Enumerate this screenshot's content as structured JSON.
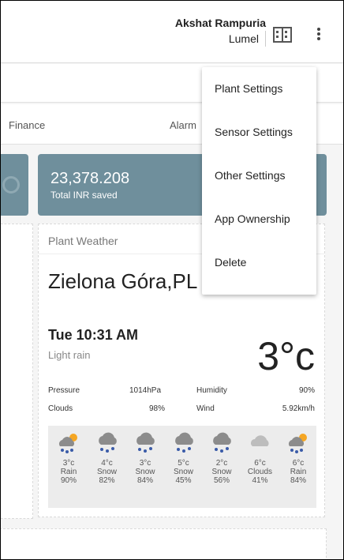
{
  "header": {
    "user_name": "Akshat Rampuria",
    "org_name": "Lumel"
  },
  "tabs": {
    "finance": "Finance",
    "alarm": "Alarm"
  },
  "kpi": {
    "value": "23,378.208",
    "label": "Total INR saved"
  },
  "weather": {
    "panel_title": "Plant Weather",
    "city": "Zielona Góra,PL",
    "time": "Tue 10:31 AM",
    "description": "Light rain",
    "temperature": "3°c",
    "stats": {
      "pressure_label": "Pressure",
      "pressure_value": "1014hPa",
      "humidity_label": "Humidity",
      "humidity_value": "90%",
      "clouds_label": "Clouds",
      "clouds_value": "98%",
      "wind_label": "Wind",
      "wind_value": "5.92km/h"
    },
    "forecast": [
      {
        "temp": "3°c",
        "cond": "Rain",
        "pct": "90%",
        "icon": "rain-sun-icon"
      },
      {
        "temp": "4°c",
        "cond": "Snow",
        "pct": "82%",
        "icon": "snow-cloud-icon"
      },
      {
        "temp": "3°c",
        "cond": "Snow",
        "pct": "84%",
        "icon": "snow-cloud-icon"
      },
      {
        "temp": "5°c",
        "cond": "Snow",
        "pct": "45%",
        "icon": "snow-cloud-icon"
      },
      {
        "temp": "2°c",
        "cond": "Snow",
        "pct": "56%",
        "icon": "snow-cloud-icon"
      },
      {
        "temp": "6°c",
        "cond": "Clouds",
        "pct": "41%",
        "icon": "cloud-icon"
      },
      {
        "temp": "6°c",
        "cond": "Rain",
        "pct": "84%",
        "icon": "rain-sun-icon"
      }
    ]
  },
  "menu": {
    "items": [
      "Plant Settings",
      "Sensor Settings",
      "Other Settings",
      "App Ownership",
      "Delete"
    ]
  },
  "colors": {
    "kpi_bg": "#6f8f9c",
    "snow_blue": "#3a5ba8",
    "cloud_gray": "#8c8c8c",
    "sun_orange": "#f5a623"
  }
}
